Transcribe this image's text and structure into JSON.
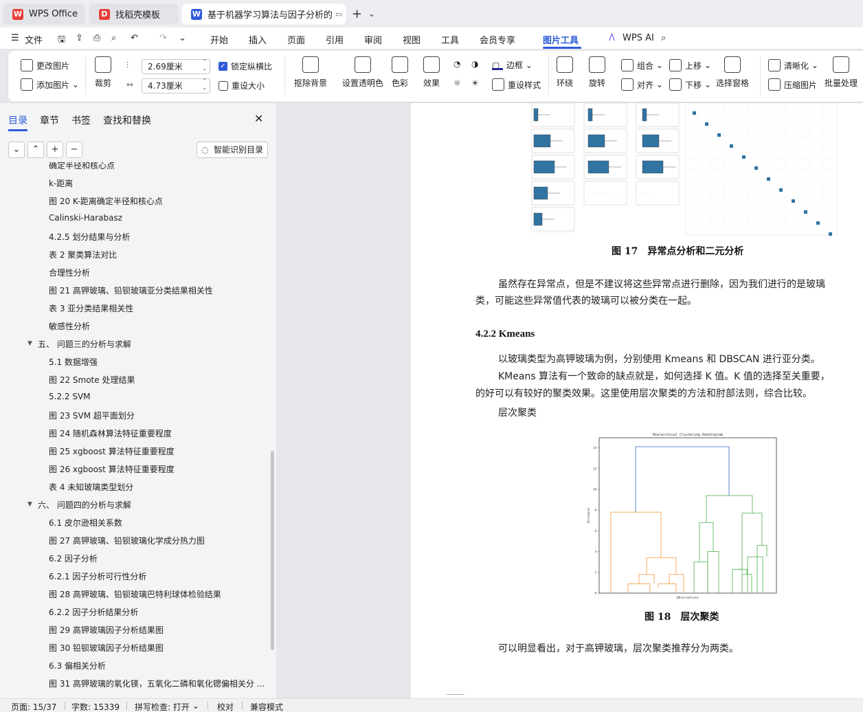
{
  "tabs": [
    {
      "label": "WPS Office",
      "icon": "wps-logo-icon"
    },
    {
      "label": "找稻壳模板",
      "icon": "docer-icon"
    },
    {
      "label": "基于机器学习算法与因子分析的",
      "icon": "word-doc-icon"
    }
  ],
  "menu": {
    "file": "文件",
    "items": [
      "开始",
      "插入",
      "页面",
      "引用",
      "审阅",
      "视图",
      "工具",
      "会员专享",
      "图片工具"
    ],
    "ai": "WPS AI"
  },
  "ribbon": {
    "change_image": "更改图片",
    "add_image": "添加图片",
    "crop": "裁剪",
    "height_value": "2.69厘米",
    "width_value": "4.73厘米",
    "lock_ratio": "锁定纵横比",
    "reset_size": "重设大小",
    "remove_bg": "抠除背景",
    "set_transparent": "设置透明色",
    "color": "色彩",
    "effect": "效果",
    "border": "边框",
    "reset_style": "重设样式",
    "wrap": "环绕",
    "rotate": "旋转",
    "group": "组合",
    "align": "对齐",
    "bring_forward": "上移",
    "send_backward": "下移",
    "selection_pane": "选择窗格",
    "sharpen": "清晰化",
    "compress": "压缩图片",
    "batch": "批量处理"
  },
  "sidebar": {
    "tabs": [
      "目录",
      "章节",
      "书签",
      "查找和替换"
    ],
    "smart_toc": "智能识别目录",
    "toc": [
      {
        "label": "确定半径和核心点",
        "level": 2
      },
      {
        "label": "k-距离",
        "level": 2
      },
      {
        "label": "图 20 K-距离确定半径和核心点",
        "level": 2
      },
      {
        "label": "Calinski-Harabasz",
        "level": 2
      },
      {
        "label": "4.2.5 划分结果与分析",
        "level": 2
      },
      {
        "label": "表 2 聚类算法对比",
        "level": 2
      },
      {
        "label": "合理性分析",
        "level": 2
      },
      {
        "label": "图 21 高钾玻璃、铅钡玻璃亚分类结果相关性",
        "level": 2
      },
      {
        "label": "表 3 亚分类结果相关性",
        "level": 2
      },
      {
        "label": "敏感性分析",
        "level": 2
      },
      {
        "label": "五、 问题三的分析与求解",
        "level": 1
      },
      {
        "label": "5.1 数据增强",
        "level": 2
      },
      {
        "label": "图 22 Smote 处理结果",
        "level": 2
      },
      {
        "label": "5.2.2 SVM",
        "level": 2
      },
      {
        "label": "图 23 SVM 超平面划分",
        "level": 2
      },
      {
        "label": "图 24 随机森林算法特征重要程度",
        "level": 2
      },
      {
        "label": "图 25 xgboost 算法特征重要程度",
        "level": 2
      },
      {
        "label": "图 26 xgboost 算法特征重要程度",
        "level": 2
      },
      {
        "label": "表 4 未知玻璃类型划分",
        "level": 2
      },
      {
        "label": "六、 问题四的分析与求解",
        "level": 1
      },
      {
        "label": "6.1 皮尔逊相关系数",
        "level": 2
      },
      {
        "label": "图 27 高钾玻璃、铅钡玻璃化学成分热力图",
        "level": 2
      },
      {
        "label": "6.2 因子分析",
        "level": 2
      },
      {
        "label": "6.2.1 因子分析可行性分析",
        "level": 2
      },
      {
        "label": "图 28 高钾玻璃、铅钡玻璃巴特利球体检验结果",
        "level": 2
      },
      {
        "label": "6.2.2 因子分析结果分析",
        "level": 2
      },
      {
        "label": "图 29 高钾玻璃因子分析结果图",
        "level": 2
      },
      {
        "label": "图 30 铅钡玻璃因子分析结果图",
        "level": 2
      },
      {
        "label": "6.3 偏相关分析",
        "level": 2
      },
      {
        "label": "图 31 高钾玻璃的氧化镁，五氧化二磷和氧化锶偏相关分 ...",
        "level": 2
      }
    ]
  },
  "document": {
    "fig17_caption": "图 17　异常点分析和二元分析",
    "para1_line1": "虽然存在异常点，但是不建议将这些异常点进行删除，因为我们进行的是玻璃",
    "para1_line2": "类，可能这些异常值代表的玻璃可以被分类在一起。",
    "heading": "4.2.2 Kmeans",
    "para2": "以玻璃类型为高钾玻璃为例，分别使用 Kmeans 和 DBSCAN 进行亚分类。",
    "para3_line1": "KMeans 算法有一个致命的缺点就是，如何选择 K 值。K 值的选择至关重要，",
    "para3_line2": "的好可以有较好的聚类效果。这里使用层次聚类的方法和肘部法则，综合比较。",
    "subhead": "层次聚类",
    "dendro_title": "Hierarchical Clustering Dendrogram",
    "dendro_xlabel": "Observations",
    "dendro_ylabel": "Distance",
    "dendro_yticks": [
      "14",
      "12",
      "10",
      "8",
      "6",
      "4",
      "2",
      "0"
    ],
    "fig18_caption": "图 18　层次聚类",
    "para4": "可以明显看出，对于高钾玻璃，层次聚类推荐分为两类。"
  },
  "status": {
    "page": "页面: 15/37",
    "words": "字数: 15339",
    "spell": "拼写检查: 打开",
    "proof": "校对",
    "compat": "兼容模式"
  },
  "colors": {
    "accent": "#2e5bd8",
    "dendro_orange": "#f5a150",
    "dendro_green": "#5cb85c",
    "dendro_blue": "#4a7ac7"
  }
}
